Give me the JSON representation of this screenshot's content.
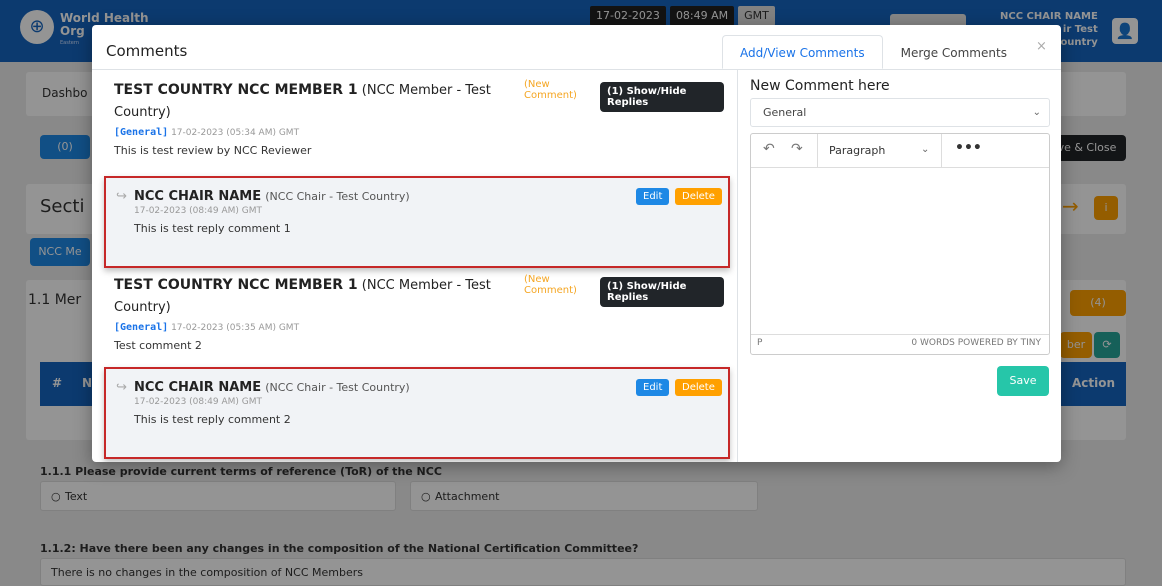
{
  "header": {
    "logo_line1": "World Health",
    "logo_line2": "Org",
    "logo_sub": "Eastern",
    "date": "17-02-2023",
    "time": "08:49 AM",
    "timezone": "GMT",
    "user_name": "NCC CHAIR NAME",
    "user_role_line1": "ir Test",
    "user_role_line2": "ountry"
  },
  "background": {
    "nav_item": "Dashbo",
    "comments_count_btn": "(0)",
    "save_close_btn": "ve & Close",
    "section_title": "Secti",
    "tab_label": "NCC Me",
    "members_title": "1.1 Mer",
    "count_badge": "(4)",
    "member_btn": "ber",
    "table_hash": "#",
    "table_n": "N",
    "table_action": "Action",
    "q1": "1.1.1 Please provide current terms of reference (ToR) of the NCC",
    "q1_opt1": "Text",
    "q1_opt2": "Attachment",
    "q2": "1.1.2: Have there been any changes in the composition of the National Certification Committee?",
    "q2_answer": "There is no changes in the composition of NCC Members"
  },
  "modal": {
    "title": "Comments",
    "tabs": [
      {
        "label": "Add/View Comments",
        "active": true
      },
      {
        "label": "Merge Comments",
        "active": false
      }
    ],
    "close": "×",
    "comments": [
      {
        "author": "TEST COUNTRY NCC MEMBER 1",
        "role": "(NCC Member - Test Country)",
        "new_line1": "(New",
        "new_line2": "Comment)",
        "toggle": "(1) Show/Hide Replies",
        "category": "[General]",
        "date": "17-02-2023 (05:34 AM) GMT",
        "body": "This is test review by NCC Reviewer",
        "reply": {
          "author": "NCC CHAIR NAME",
          "role": "(NCC Chair - Test Country)",
          "date": "17-02-2023 (08:49 AM) GMT",
          "body": "This is test reply comment 1",
          "edit": "Edit",
          "delete": "Delete"
        }
      },
      {
        "author": "TEST COUNTRY NCC MEMBER 1",
        "role": "(NCC Member - Test Country)",
        "new_line1": "(New",
        "new_line2": "Comment)",
        "toggle": "(1) Show/Hide Replies",
        "category": "[General]",
        "date": "17-02-2023 (05:35 AM) GMT",
        "body": "Test comment 2",
        "reply": {
          "author": "NCC CHAIR NAME",
          "role": "(NCC Chair - Test Country)",
          "date": "17-02-2023 (08:49 AM) GMT",
          "body": "This is test reply comment 2",
          "edit": "Edit",
          "delete": "Delete"
        }
      }
    ],
    "form": {
      "title": "New Comment here",
      "category_selected": "General",
      "editor": {
        "block_format": "Paragraph",
        "path": "P",
        "status": "0 WORDS  POWERED BY TINY"
      },
      "save": "Save"
    }
  },
  "colors": {
    "header_blue": "#1565c0",
    "tab_active": "#1a73e8",
    "highlight_border": "#c62828",
    "new_comment": "#f5a623",
    "save_button": "#26c6a9"
  }
}
